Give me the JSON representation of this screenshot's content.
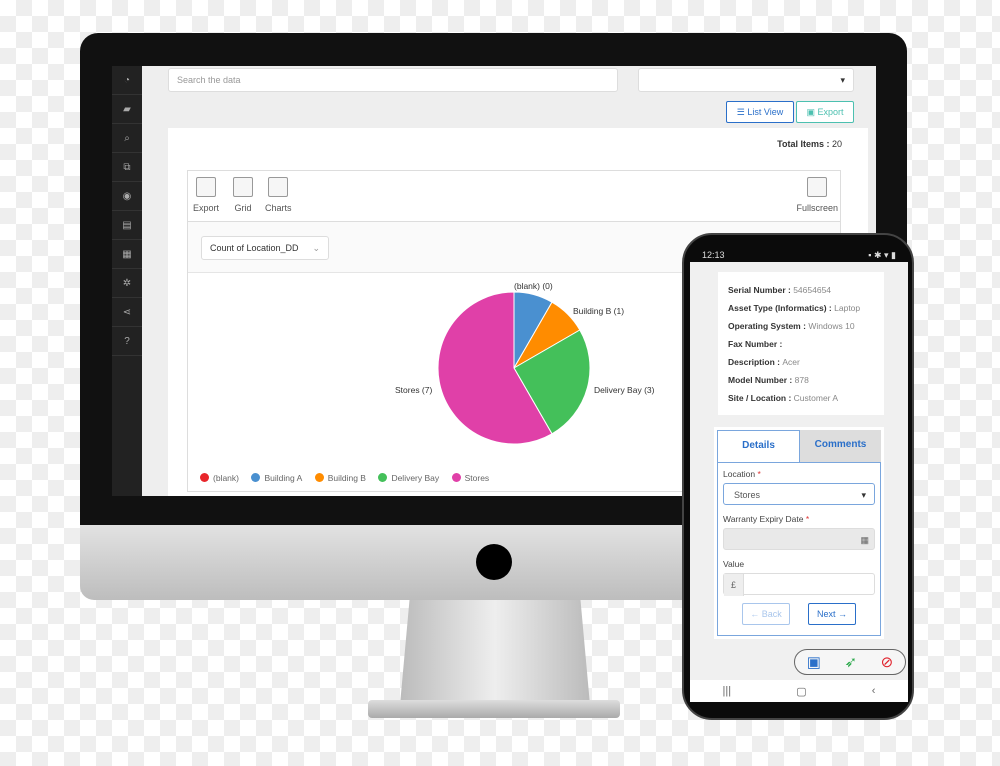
{
  "sidebar": {
    "icons": [
      "dashboard-icon",
      "book-icon",
      "search-icon",
      "devices-icon",
      "target-icon",
      "document-icon",
      "calendar-icon",
      "gear-icon",
      "share-icon",
      "help-icon"
    ]
  },
  "search": {
    "placeholder": "Search the data"
  },
  "toolbar": {
    "list_view": "List View",
    "export": "Export"
  },
  "total": {
    "label": "Total Items :",
    "value": "20"
  },
  "widget": {
    "tools": [
      "Export",
      "Grid",
      "Charts"
    ],
    "fullscreen": "Fullscreen",
    "measure": "Count of Location_DD"
  },
  "chart_data": {
    "type": "pie",
    "categories": [
      "(blank)",
      "Building A",
      "Building B",
      "Delivery Bay",
      "Stores"
    ],
    "values": [
      0,
      1,
      1,
      3,
      7
    ],
    "labels": [
      "(blank) (0)",
      "Building B (1)",
      "Delivery Bay (3)",
      "Stores (7)"
    ],
    "colors": [
      "#e8262b",
      "#4a90d0",
      "#ff8c00",
      "#44c05a",
      "#e040a8"
    ],
    "legend": "bottom"
  },
  "phone": {
    "time": "12:13",
    "info": [
      {
        "k": "Serial Number :",
        "v": "54654654"
      },
      {
        "k": "Asset Type (Informatics) :",
        "v": "Laptop"
      },
      {
        "k": "Operating System :",
        "v": "Windows 10"
      },
      {
        "k": "Fax Number :",
        "v": ""
      },
      {
        "k": "Description :",
        "v": "Acer"
      },
      {
        "k": "Model Number :",
        "v": "878"
      },
      {
        "k": "Site / Location :",
        "v": "Customer A"
      }
    ],
    "tabs": [
      "Details",
      "Comments"
    ],
    "location_label": "Location",
    "location_value": "Stores",
    "warranty_label": "Warranty Expiry Date",
    "value_label": "Value",
    "currency": "£",
    "required": "*",
    "back": "← Back",
    "next": "Next →"
  },
  "colors": {
    "accent": "#2a6fc9",
    "teal": "#4cc0b0"
  }
}
